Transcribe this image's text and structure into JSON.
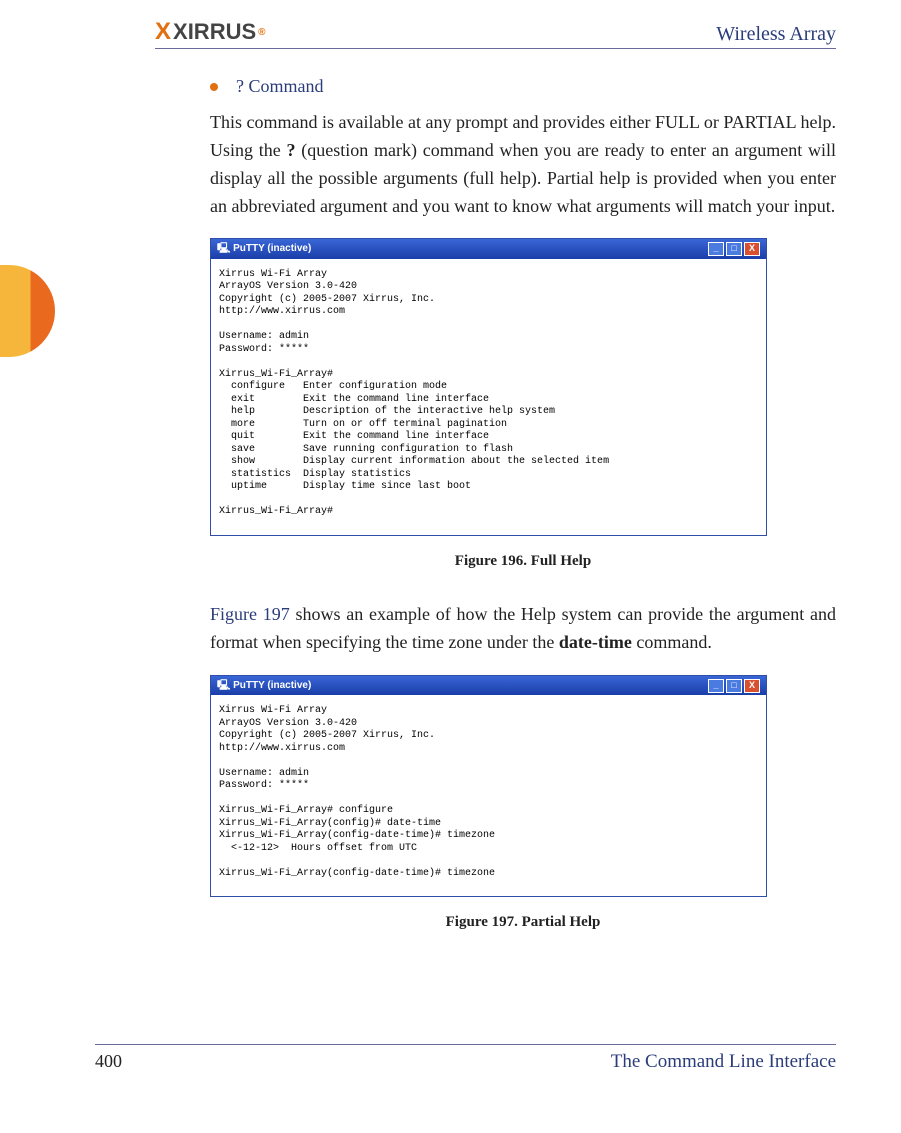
{
  "header": {
    "logo_text": "XIRRUS",
    "doc_title": "Wireless Array"
  },
  "section": {
    "heading": "? Command",
    "body_before_q": "This command is available at any prompt and provides either FULL or PARTIAL help. Using the ",
    "q_char": "?",
    "body_after_q": " (question mark) command when you are ready to enter an argument will display all the possible arguments (full help). Partial help is provided when you enter an abbreviated argument and you want to know what arguments will match your input."
  },
  "figure1": {
    "window_title": "PuTTY (inactive)",
    "terminal": "Xirrus Wi-Fi Array\nArrayOS Version 3.0-420\nCopyright (c) 2005-2007 Xirrus, Inc.\nhttp://www.xirrus.com\n\nUsername: admin\nPassword: *****\n\nXirrus_Wi-Fi_Array#\n  configure   Enter configuration mode\n  exit        Exit the command line interface\n  help        Description of the interactive help system\n  more        Turn on or off terminal pagination\n  quit        Exit the command line interface\n  save        Save running configuration to flash\n  show        Display current information about the selected item\n  statistics  Display statistics\n  uptime      Display time since last boot\n\nXirrus_Wi-Fi_Array#",
    "caption": "Figure 196. Full Help"
  },
  "para2": {
    "figref": "Figure 197 ",
    "text_after_ref": " shows an example of how the Help system can provide the argument and format when specifying the time zone under the ",
    "datetime_bold": "date-time",
    "text_end": " command."
  },
  "figure2": {
    "window_title": "PuTTY (inactive)",
    "terminal": "Xirrus Wi-Fi Array\nArrayOS Version 3.0-420\nCopyright (c) 2005-2007 Xirrus, Inc.\nhttp://www.xirrus.com\n\nUsername: admin\nPassword: *****\n\nXirrus_Wi-Fi_Array# configure\nXirrus_Wi-Fi_Array(config)# date-time\nXirrus_Wi-Fi_Array(config-date-time)# timezone\n  <-12-12>  Hours offset from UTC\n\nXirrus_Wi-Fi_Array(config-date-time)# timezone",
    "caption": "Figure 197. Partial Help"
  },
  "footer": {
    "page_number": "400",
    "section_title": "The Command Line Interface"
  }
}
